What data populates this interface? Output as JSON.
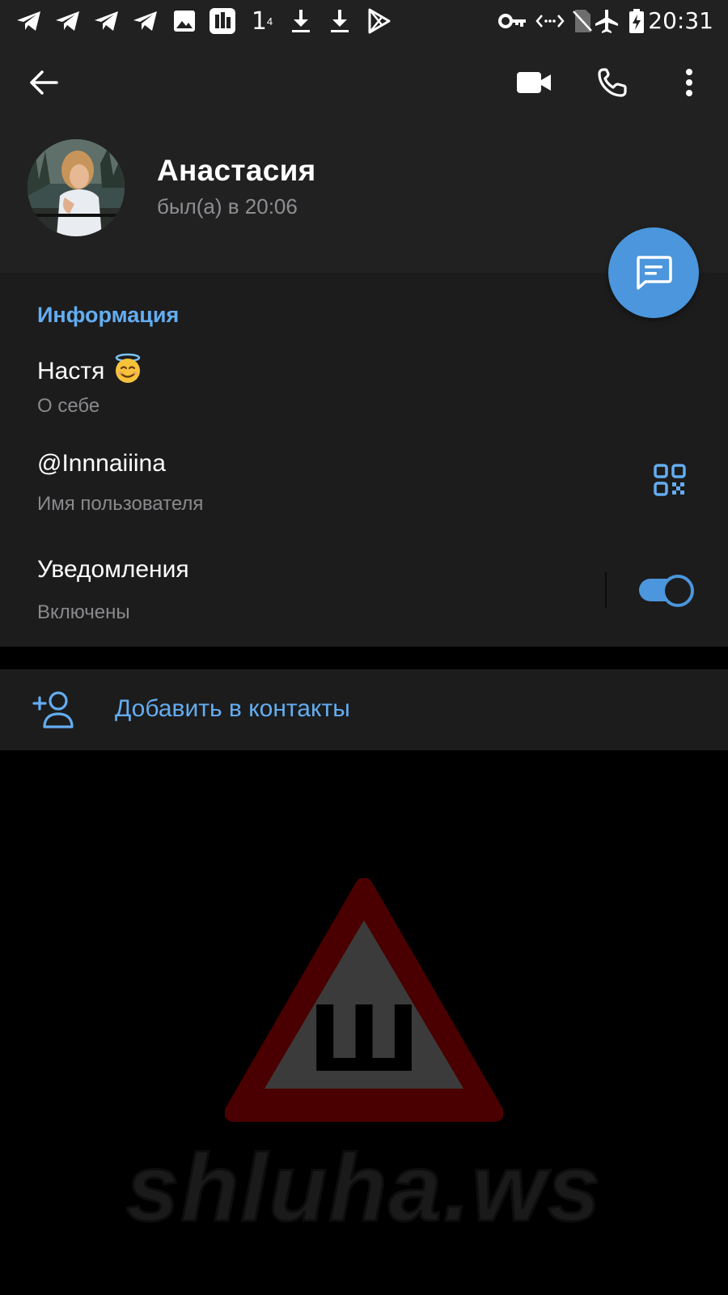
{
  "status_bar": {
    "time": "20:31",
    "notification_icons": [
      "telegram-icon",
      "telegram-icon",
      "telegram-icon",
      "telegram-icon",
      "image-icon",
      "app-icon",
      "temperature-icon",
      "download-icon",
      "download-icon",
      "play-store-icon"
    ],
    "system_icons": [
      "vpn-key-icon",
      "data-saver-icon",
      "no-sim-icon",
      "airplane-mode-icon",
      "battery-charging-icon"
    ],
    "temperature": "1",
    "temperature_sup": "4"
  },
  "header": {
    "back_icon": "arrow-left-icon",
    "video_call_icon": "video-camera-icon",
    "call_icon": "phone-icon",
    "more_icon": "more-vertical-icon",
    "name": "Анастасия",
    "last_seen": "был(а) в 20:06",
    "fab_icon": "message-icon"
  },
  "info": {
    "title": "Информация",
    "bio": "Настя",
    "bio_emoji": "smiling-face-with-halo",
    "bio_label": "О себе",
    "username": "@Innnaiiina",
    "username_label": "Имя пользователя",
    "notifications": "Уведомления",
    "notifications_state": "Включены",
    "notifications_enabled": true
  },
  "actions": {
    "add_contact": "Добавить в контакты"
  },
  "watermark": {
    "sign_letter": "Ш",
    "text": "shluha.ws"
  },
  "colors": {
    "accent": "#64adf0",
    "fab": "#4b96dc",
    "header_bg": "#212121",
    "section_bg": "#1c1c1d",
    "subtext": "#8a8a8d"
  }
}
